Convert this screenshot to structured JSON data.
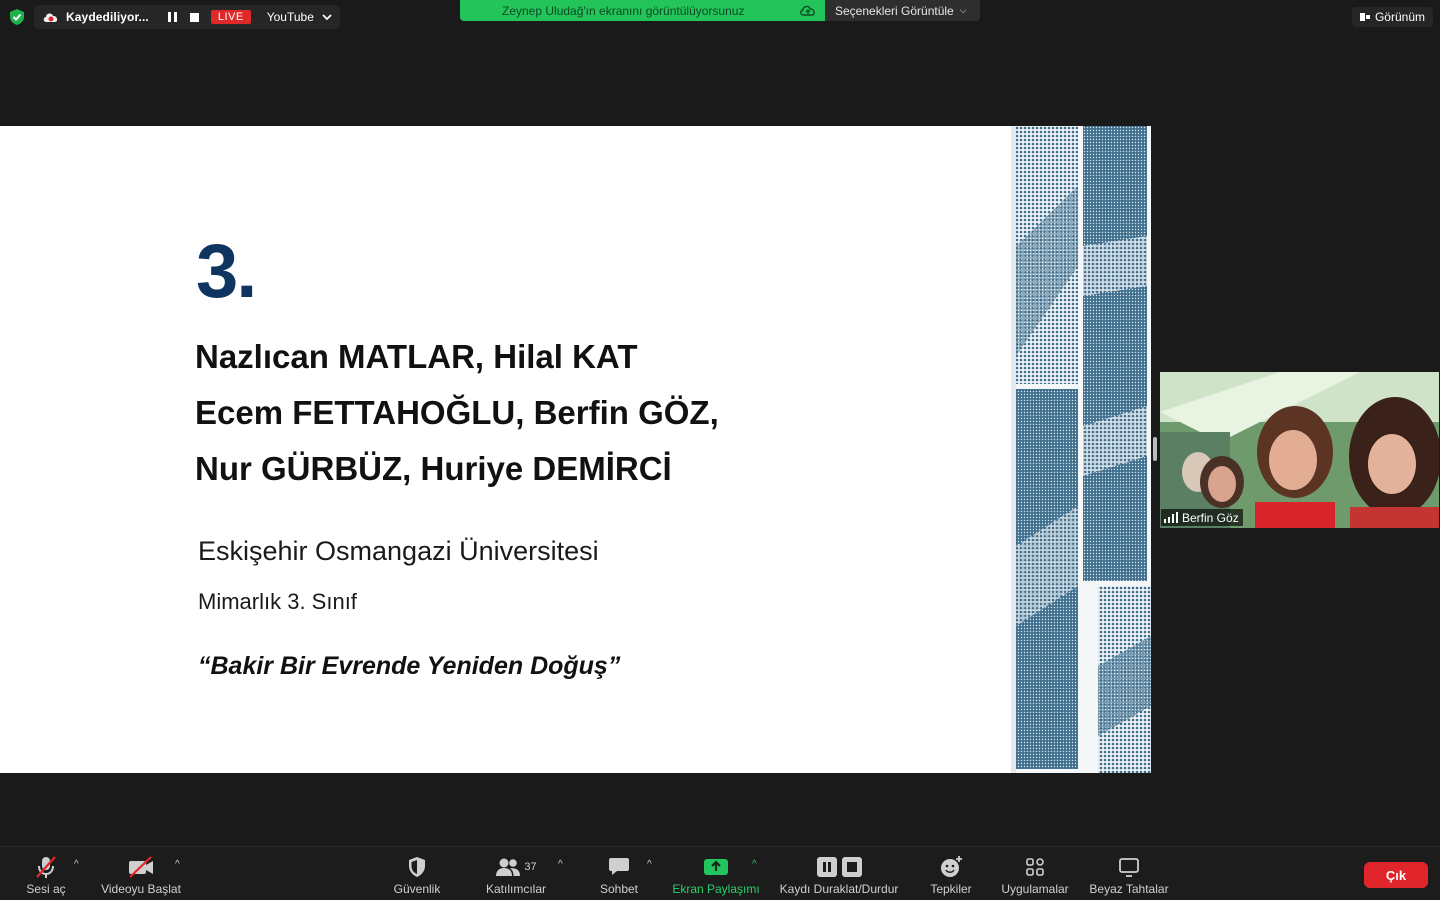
{
  "topbar": {
    "recording_label": "Kaydediliyor...",
    "live_label": "LIVE",
    "stream_target": "YouTube",
    "share_banner": "Zeynep Uludağ'ın ekranını görüntülüyorsunuz",
    "view_options": "Seçenekleri Görüntüle",
    "view_label": "Görünüm"
  },
  "slide": {
    "number": "3.",
    "names": [
      "Nazlıcan MATLAR, Hilal KAT",
      "Ecem FETTAHOĞLU, Berfin GÖZ,",
      "Nur GÜRBÜZ, Huriye DEMİRCİ"
    ],
    "university": "Eskişehir Osmangazi Üniversitesi",
    "class": "Mimarlık 3. Sınıf",
    "project_title": "“Bakir Bir Evrende Yeniden Doğuş”"
  },
  "participant": {
    "name": "Berfin Göz"
  },
  "toolbar": {
    "mute": "Sesi aç",
    "video": "Videoyu Başlat",
    "security": "Güvenlik",
    "participants": "Katılımcılar",
    "participants_count": "37",
    "chat": "Sohbet",
    "share": "Ekran Paylaşımı",
    "record": "Kaydı Duraklat/Durdur",
    "reactions": "Tepkiler",
    "apps": "Uygulamalar",
    "whiteboards": "Beyaz Tahtalar",
    "exit": "Çık"
  },
  "colors": {
    "share_green": "#23c45a",
    "live_red": "#e02828",
    "exit_red": "#e0262a",
    "slide_accent": "#0e3560",
    "halftone_blue": "#3e6f8f"
  }
}
